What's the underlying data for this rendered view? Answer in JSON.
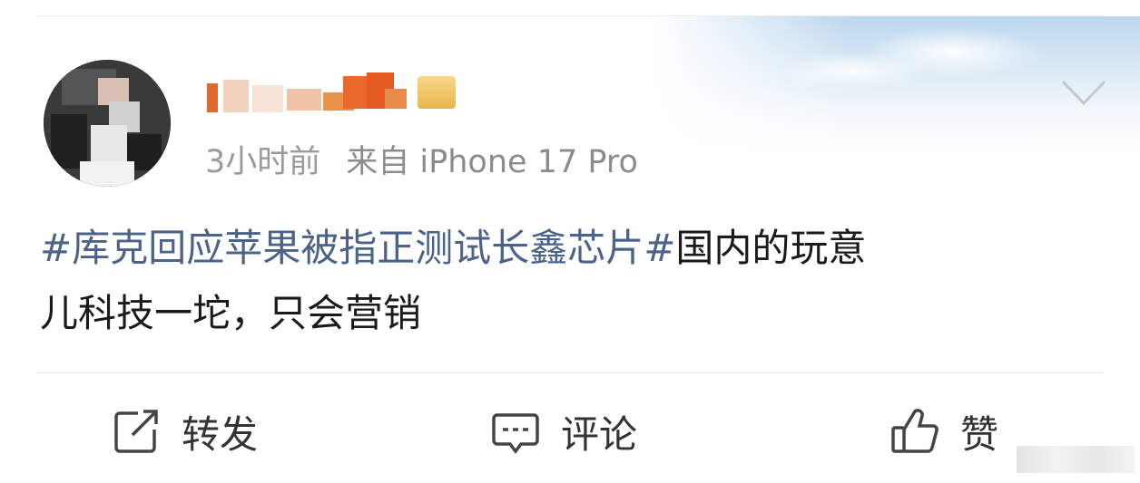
{
  "post": {
    "time": "3小时前",
    "source": "来自 iPhone 17 Pro",
    "hashtag": "#库克回应苹果被指正测试长鑫芯片#",
    "text_line1_rest": "国内的玩意",
    "text_line2": "儿科技一坨，只会营销"
  },
  "actions": {
    "repost": "转发",
    "comment": "评论",
    "like": "赞"
  },
  "icons": {
    "repost": "edit-share-icon",
    "comment": "comment-bubble-icon",
    "like": "thumbs-up-icon",
    "more": "chevron-down-icon"
  }
}
